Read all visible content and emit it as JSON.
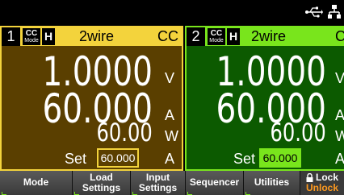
{
  "topbar": {
    "usb_icon": "usb-icon",
    "lan_icon": "lan-icon"
  },
  "channels": [
    {
      "number": "1",
      "mode_top": "CC",
      "mode_bottom": "Mode",
      "range": "H",
      "sense": "2wire",
      "mode_right": "CC",
      "voltage": "1.0000",
      "voltage_unit": "V",
      "current": "60.000",
      "current_unit": "A",
      "power": "60.00",
      "power_unit": "W",
      "set_label": "Set",
      "set_value": "60.000",
      "set_unit": "A",
      "colors": {
        "frame": "#f3d33c",
        "background": "#5a3f00"
      }
    },
    {
      "number": "2",
      "mode_top": "CC",
      "mode_bottom": "Mode",
      "range": "H",
      "sense": "2wire",
      "mode_right": "C",
      "voltage": "1.0000",
      "voltage_unit": "V",
      "current": "60.000",
      "current_unit": "A",
      "power": "60.00",
      "power_unit": "W",
      "set_label": "Set",
      "set_value": "60.000",
      "set_unit": "A",
      "colors": {
        "frame": "#79e51c",
        "background": "#0c5a00"
      }
    }
  ],
  "softkeys": {
    "mode": "Mode",
    "load_settings_1": "Load",
    "load_settings_2": "Settings",
    "input_settings_1": "Input",
    "input_settings_2": "Settings",
    "sequencer": "Sequencer",
    "utilities": "Utilities",
    "lock_1": "Lock",
    "lock_2": "Unlock"
  }
}
